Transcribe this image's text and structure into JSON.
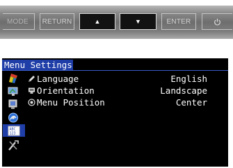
{
  "panel": {
    "mode_label": "MODE",
    "return_label": "RETURN",
    "up_label": "▲",
    "down_label": "▼",
    "enter_label": "ENTER",
    "power_icon": "power-icon"
  },
  "osd": {
    "title": "Menu Settings",
    "side_icons": [
      "color-icon",
      "screen-icon",
      "monitor-settings-icon",
      "power-save-icon",
      "osd-settings-icon",
      "tools-icon"
    ],
    "selected_side_index": 4,
    "rows": [
      {
        "label": "Language",
        "value": "English",
        "icon": "pencil-icon"
      },
      {
        "label": "Orientation",
        "value": "Landscape",
        "icon": "monitor-icon"
      },
      {
        "label": "Menu Position",
        "value": "Center",
        "icon": "position-icon"
      }
    ],
    "colors": {
      "title_bg": "#1f3ea8",
      "background": "#000000",
      "text": "#ffffff"
    }
  }
}
